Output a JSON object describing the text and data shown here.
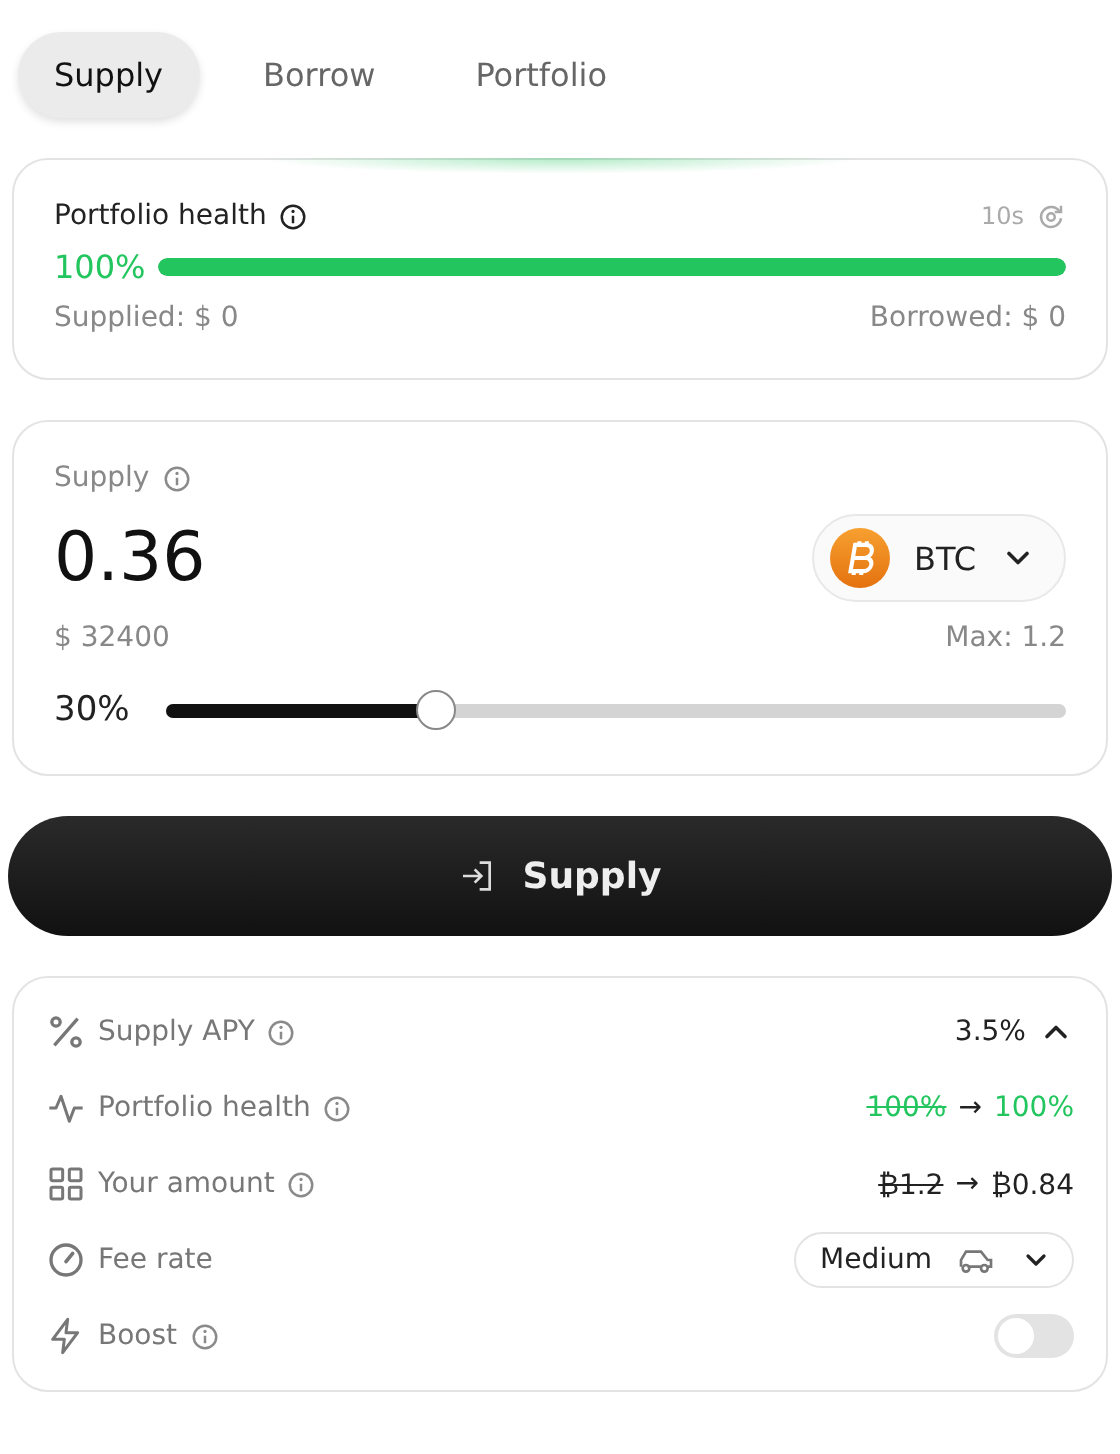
{
  "tabs": [
    {
      "label": "Supply",
      "selected": true
    },
    {
      "label": "Borrow",
      "selected": false
    },
    {
      "label": "Portfolio",
      "selected": false
    }
  ],
  "health": {
    "title": "Portfolio health",
    "refresh": "10s",
    "percent": "100%",
    "level": 1,
    "supplied": "Supplied: $ 0",
    "borrowed": "Borrowed: $ 0"
  },
  "supply": {
    "label": "Supply",
    "amount": "0.36",
    "asset": "BTC",
    "usd": "$ 32400",
    "max": "Max: 1.2",
    "percent": "30%",
    "level": 0.3
  },
  "action": {
    "label": "Supply"
  },
  "details": {
    "expanded": true,
    "rows": [
      {
        "kind": "value",
        "label": "Supply APY",
        "value": "3.5%",
        "info": true
      },
      {
        "kind": "change",
        "label": "Portfolio health",
        "from": "100%",
        "arrow": "→",
        "to": "100%",
        "color": "#22c55e",
        "info": true
      },
      {
        "kind": "change",
        "label": "Your amount",
        "from": "₿1.2",
        "arrow": "→",
        "to": "₿0.84",
        "color": "#222222",
        "info": true
      },
      {
        "kind": "select",
        "label": "Fee rate",
        "value": "Medium",
        "info": false
      },
      {
        "kind": "toggle",
        "label": "Boost",
        "on": false,
        "info": true
      }
    ]
  }
}
